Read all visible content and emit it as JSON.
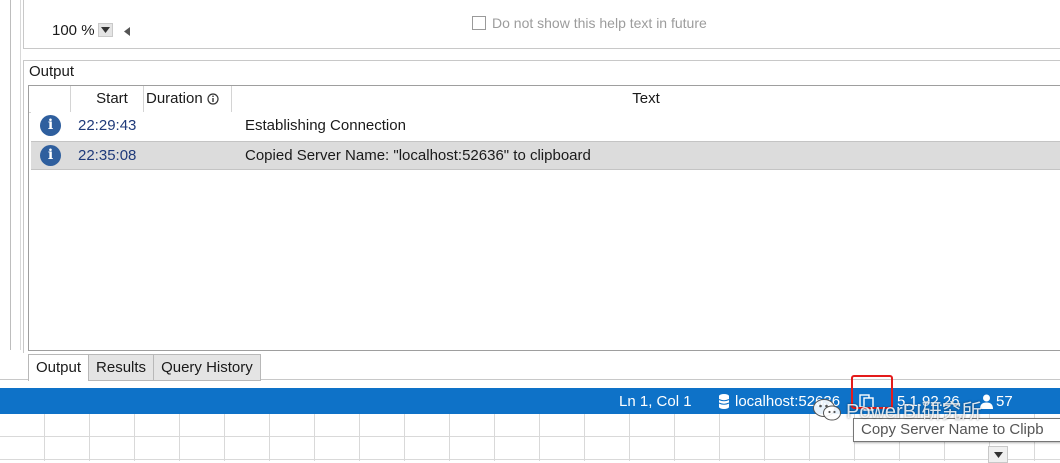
{
  "editor": {
    "zoom": "100 %",
    "help_checkbox_label": "Do not show this help text in future",
    "help_checkbox_checked": false
  },
  "output": {
    "title": "Output",
    "columns": [
      "Start",
      "Duration",
      "Text"
    ],
    "rows": [
      {
        "icon": "info-icon",
        "start": "22:29:43",
        "duration": "",
        "text": "Establishing Connection"
      },
      {
        "icon": "info-icon",
        "start": "22:35:08",
        "duration": "",
        "text": "Copied Server Name: \"localhost:52636\" to clipboard"
      }
    ]
  },
  "tabs": [
    "Output",
    "Results",
    "Query History"
  ],
  "status": {
    "position": "Ln 1, Col 1",
    "server": "localhost:52636",
    "version": "5.1.92.26",
    "count": "57",
    "bar_color": "#0e72c8",
    "highlight_color": "#e41b1b"
  },
  "tooltip": {
    "text": "Copy Server Name to Clipb"
  },
  "watermark": {
    "text": "PowerBI研究所"
  }
}
